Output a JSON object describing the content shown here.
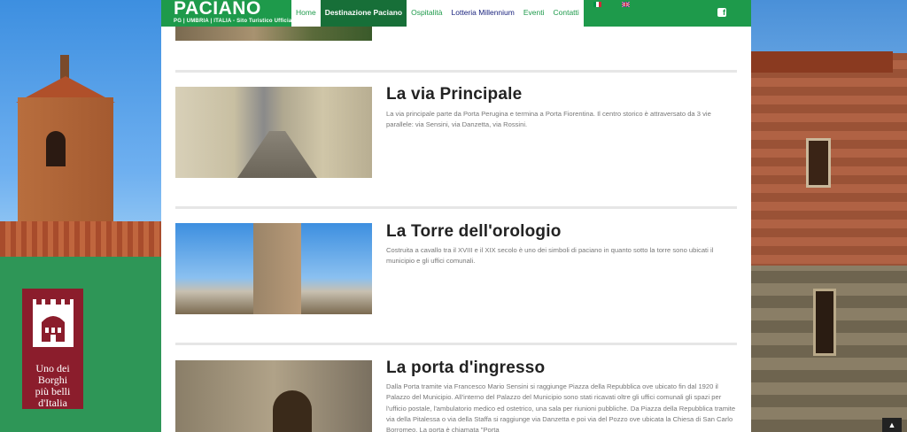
{
  "header": {
    "logo_title": "PACIANO",
    "logo_sub": "PG | UMBRIA | ITALIA - Sito Turistico Ufficiale",
    "nav": [
      {
        "label": "Home"
      },
      {
        "label": "Destinazione Paciano"
      },
      {
        "label": "Ospitalità"
      },
      {
        "label": "Lotteria Millennium"
      },
      {
        "label": "Eventi"
      },
      {
        "label": "Contatti"
      }
    ],
    "flags": [
      "flag-italy-icon",
      "flag-uk-icon"
    ],
    "social": "facebook-icon"
  },
  "badge": {
    "line1": "Uno dei",
    "line2": "Borghi",
    "line3": "più belli",
    "line4": "d'Italia"
  },
  "articles": [
    {
      "title": "La via Principale",
      "text": "La via principale parte da Porta Perugina e termina a Porta Fiorentina. Il centro storico è attraversato da 3 vie parallele: via Sensini, via Danzetta, via Rossini."
    },
    {
      "title": "La Torre dell'orologio",
      "text": "Costruita a cavallo tra il XVIII e il XIX secolo è uno dei simboli di paciano in quanto sotto la torre sono ubicati il municipio e gli uffici comunali."
    },
    {
      "title": "La porta d'ingresso",
      "text": "Dalla Porta tramite via Francesco Mario Sensini si raggiunge Piazza della Repubblica ove ubicato fin dal 1920 il Palazzo del Municipio. All'interno del Palazzo del Municipio sono stati ricavati oltre gli uffici comunali gli spazi per l'ufficio postale, l'ambulatorio medico ed ostetrico, una sala per riunioni pubbliche. Da Piazza della Repubblica tramite via della Pitalessa o via della Staffa si raggiunge via Danzetta e poi via del Pozzo ove ubicata la Chiesa di San Carlo Borromeo. La porta è chiamata \"Porta"
    }
  ],
  "colors": {
    "header_green": "#1e9a4b",
    "badge_red": "#8b1d2c",
    "nav_blue": "#1a237e"
  }
}
